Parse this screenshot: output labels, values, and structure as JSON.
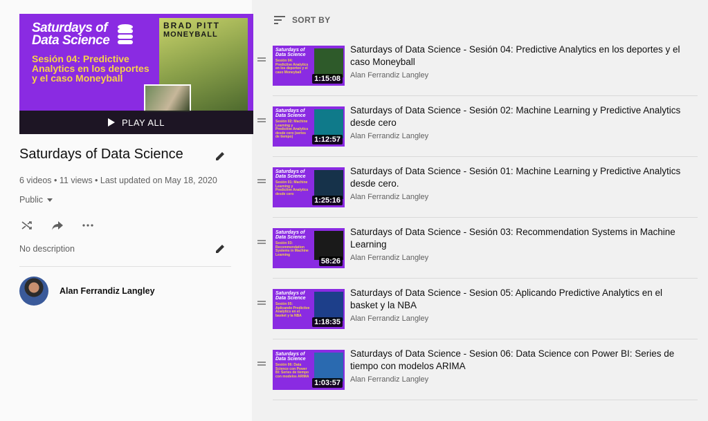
{
  "playlist": {
    "hero": {
      "brand_line1": "Saturdays of",
      "brand_line2": "Data Science",
      "subtitle": "Sesión 04: Predictive Analytics en los deportes y el caso Moneyball",
      "poster_line1": "BRAD PITT",
      "poster_line2": "MONEYBALL",
      "play_all_label": "PLAY ALL"
    },
    "title": "Saturdays of Data Science",
    "meta": "6 videos • 11 views • Last updated on May 18, 2020",
    "privacy": "Public",
    "description": "No description",
    "owner": "Alan Ferrandiz Langley"
  },
  "sort": {
    "label": "SORT BY"
  },
  "videos": [
    {
      "title": "Saturdays of Data Science - Sesión 04: Predictive Analytics en los deportes y el caso Moneyball",
      "channel": "Alan Ferrandiz Langley",
      "duration": "1:15:08",
      "thumb_sub": "Sesión 04: Predictive Analytics en los deportes y el caso Moneyball",
      "thumb_color": "#2e5a2a"
    },
    {
      "title": "Saturdays of Data Science - Sesión 02: Machine Learning y Predictive Analytics desde cero",
      "channel": "Alan Ferrandiz Langley",
      "duration": "1:12:57",
      "thumb_sub": "Sesión 02: Machine Learning y Predictive Analytics desde cero (series de tiempo)",
      "thumb_color": "#0f7a8a"
    },
    {
      "title": "Saturdays of Data Science - Sesión 01: Machine Learning y Predictive Analytics desde cero.",
      "channel": "Alan Ferrandiz Langley",
      "duration": "1:25:16",
      "thumb_sub": "Sesión 01: Machine Learning y Predictive Analytics desde cero",
      "thumb_color": "#16324a"
    },
    {
      "title": "Saturdays of Data Science - Sesión 03: Recommendation Systems in Machine Learning",
      "channel": "Alan Ferrandiz Langley",
      "duration": "58:26",
      "thumb_sub": "Sesión 03: Recommendation Systems in Machine Learning",
      "thumb_color": "#1a1a1a"
    },
    {
      "title": "Saturdays of Data Science - Sesion 05: Aplicando Predictive Analytics en el basket y la NBA",
      "channel": "Alan Ferrandiz Langley",
      "duration": "1:18:35",
      "thumb_sub": "Sesión 05: Aplicando Predictive Analytics en el basket y la NBA",
      "thumb_color": "#1d3f8a"
    },
    {
      "title": "Saturdays of Data Science - Sesion 06: Data Science con Power BI: Series de tiempo con modelos ARIMA",
      "channel": "Alan Ferrandiz Langley",
      "duration": "1:03:57",
      "thumb_sub": "Sesión 06: Data Science con Power BI: Series de tiempo con modelos ARIMA",
      "thumb_color": "#2a6ab0"
    }
  ],
  "colors": {
    "accent_purple": "#8a2be2",
    "accent_yellow": "#f7d14a"
  }
}
